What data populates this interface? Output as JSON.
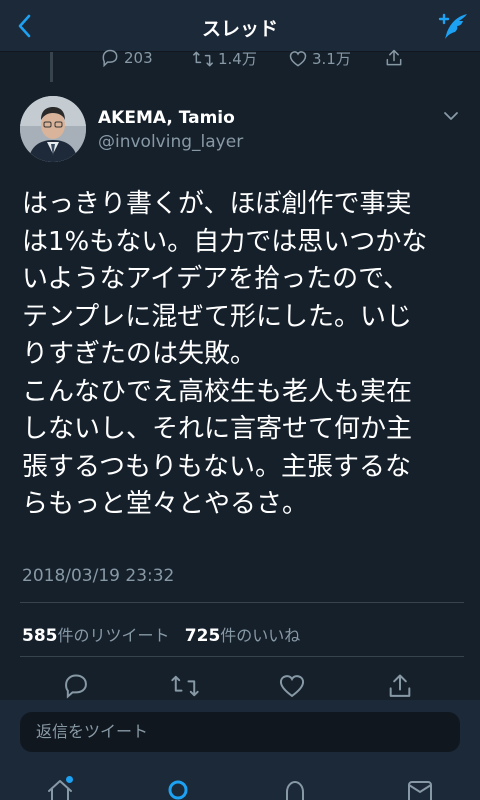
{
  "header": {
    "title": "スレッド"
  },
  "parent_tweet": {
    "reply_count": "203",
    "retweet_count": "1.4万",
    "like_count": "3.1万"
  },
  "tweet": {
    "author_name": "AKEMA, Tamio",
    "author_handle": "@involving_layer",
    "text": "はっきり書くが、ほぼ創作で事実\nは1%もない。自力では思いつかな\nいようなアイデアを拾ったので、\nテンプレに混ぜて形にした。いじ\nりすぎたのは失敗。\nこんなひでえ高校生も老人も実在\nしないし、それに言寄せて何か主\n張するつもりもない。主張するな\nらもっと堂々とやるさ。",
    "timestamp": "2018/03/19 23:32",
    "retweet_count": "585",
    "retweet_label": "件のリツイート",
    "like_count": "725",
    "like_label": "件のいいね"
  },
  "reply_bar": {
    "placeholder": "返信をツイート"
  },
  "icons": {
    "back": "chevron-left-icon",
    "compose": "compose-tweet-icon",
    "reply": "reply-icon",
    "retweet": "retweet-icon",
    "like": "heart-icon",
    "share": "share-icon",
    "home": "home-icon",
    "search": "search-icon",
    "notifications": "bell-icon",
    "messages": "mail-icon"
  },
  "colors": {
    "background": "#15202b",
    "header": "#1c2938",
    "accent": "#1da1f2",
    "secondary_text": "#8899a6",
    "divider": "#38444d"
  }
}
